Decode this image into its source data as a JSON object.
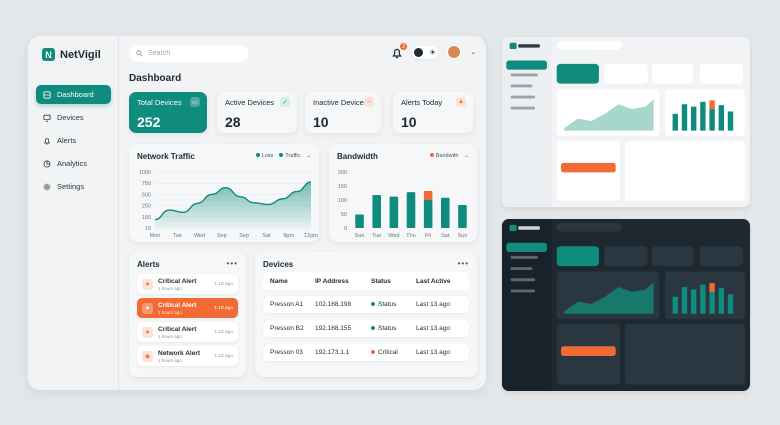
{
  "brand": {
    "logo_letter": "N",
    "name": "NetVigil"
  },
  "colors": {
    "accent": "#0f8c7d",
    "alert": "#f26b34",
    "bg": "#f1f3f5",
    "dark_bg": "#1e2830"
  },
  "nav": [
    {
      "label": "Dashboard",
      "icon": "dashboard-icon",
      "active": true
    },
    {
      "label": "Devices",
      "icon": "monitor-icon"
    },
    {
      "label": "Alerts",
      "icon": "bell-icon"
    },
    {
      "label": "Analytics",
      "icon": "chart-icon"
    },
    {
      "label": "Settings",
      "icon": "gear-icon"
    }
  ],
  "search": {
    "placeholder": "Search"
  },
  "header": {
    "notification_count": "2",
    "page_title": "Dashboard"
  },
  "stats": [
    {
      "label": "Total Devices",
      "value": "252"
    },
    {
      "label": "Active Devices",
      "value": "28"
    },
    {
      "label": "Inactive Devices",
      "value": "10"
    },
    {
      "label": "Alerts Today",
      "value": "10"
    }
  ],
  "network": {
    "title": "Network Traffic",
    "legend": [
      "Loss",
      "Traffic"
    ],
    "chart_data": {
      "type": "area",
      "x": [
        "Mon",
        "Tue",
        "Wed",
        "Sep",
        "Sep",
        "Sat",
        "9pm",
        "12pm"
      ],
      "y_ticks": [
        "1000",
        "750",
        "500",
        "250",
        "150",
        "10"
      ],
      "values": [
        150,
        320,
        280,
        440,
        600,
        720,
        560,
        450,
        420,
        520,
        650,
        820
      ],
      "ylim": [
        0,
        1000
      ]
    }
  },
  "bandwidth": {
    "title": "Bandwidth",
    "legend": "Bandwith",
    "chart_data": {
      "type": "bar",
      "categories": [
        "Sun",
        "Tue",
        "Wed",
        "Thu",
        "Fri",
        "Sat",
        "Sun"
      ],
      "y_ticks": [
        "200",
        "150",
        "100",
        "50",
        "0"
      ],
      "values": [
        48,
        118,
        112,
        128,
        132,
        108,
        82
      ],
      "highlight": [
        0,
        0,
        0,
        0,
        32,
        0,
        0
      ],
      "ylim": [
        0,
        200
      ]
    }
  },
  "alerts": {
    "title": "Alerts",
    "items": [
      {
        "title": "Critical Alert",
        "sub": "1 hours ago",
        "time": "1:16 ago",
        "active": false
      },
      {
        "title": "Critical Alert",
        "sub": "1 hours ago",
        "time": "1:16 ago",
        "active": true
      },
      {
        "title": "Critical Alert",
        "sub": "1 hours ago",
        "time": "1:13 ago",
        "active": false
      },
      {
        "title": "Network Alert",
        "sub": "1 hours ago",
        "time": "1:13 ago",
        "active": false
      }
    ]
  },
  "devices": {
    "title": "Devices",
    "columns": [
      "Name",
      "IP Address",
      "Status",
      "Last Active"
    ],
    "rows": [
      {
        "name": "Presson A1",
        "ip": "102.168.198",
        "status": "Status",
        "status_color": "#0f8c7d",
        "last": "Last 13 ago"
      },
      {
        "name": "Presson B2",
        "ip": "192.168.155",
        "status": "Status",
        "status_color": "#0f8c7d",
        "last": "Last 13 ago"
      },
      {
        "name": "Presson 03",
        "ip": "192.173.1.1",
        "status": "Critical",
        "status_color": "#f26b34",
        "last": "Last 13 ago"
      }
    ]
  }
}
